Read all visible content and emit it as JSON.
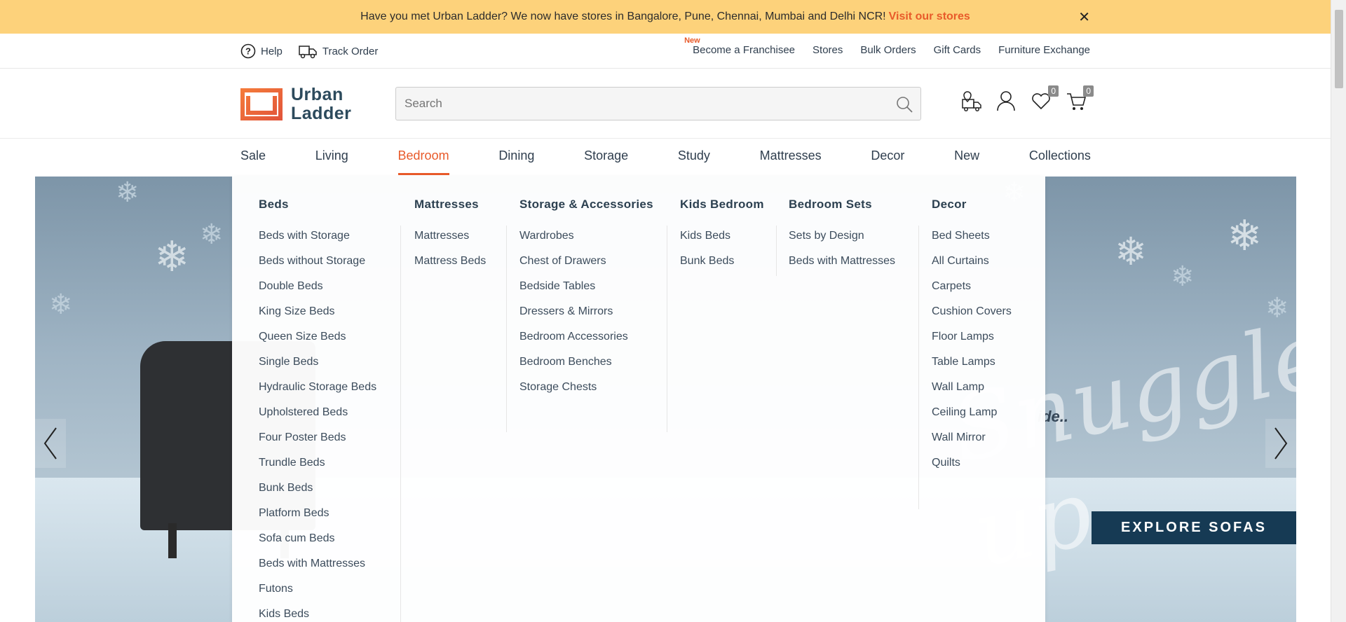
{
  "announcement": {
    "text": "Have you met Urban Ladder? We now have stores in Bangalore, Pune, Chennai, Mumbai and Delhi NCR!",
    "link": "Visit our stores",
    "close": "✕"
  },
  "util": {
    "help": "Help",
    "track": "Track Order",
    "new_badge": "New",
    "links": [
      "Become a Franchisee",
      "Stores",
      "Bulk Orders",
      "Gift Cards",
      "Furniture Exchange"
    ]
  },
  "header": {
    "logo_line1": "Urban",
    "logo_line2": "Ladder",
    "search_placeholder": "Search",
    "wishlist_count": "0",
    "cart_count": "0"
  },
  "nav": [
    "Sale",
    "Living",
    "Bedroom",
    "Dining",
    "Storage",
    "Study",
    "Mattresses",
    "Decor",
    "New",
    "Collections"
  ],
  "nav_active": "Bedroom",
  "hero": {
    "script_text": "Snuggle up",
    "tag_text": "ide..",
    "cta": "EXPLORE SOFAS"
  },
  "mega_menu": [
    {
      "title": "Beds",
      "items": [
        "Beds with Storage",
        "Beds without Storage",
        "Double Beds",
        "King Size Beds",
        "Queen Size Beds",
        "Single Beds",
        "Hydraulic Storage Beds",
        "Upholstered Beds",
        "Four Poster Beds",
        "Trundle Beds",
        "Bunk Beds",
        "Platform Beds",
        "Sofa cum Beds",
        "Beds with Mattresses",
        "Futons",
        "Kids Beds"
      ]
    },
    {
      "title": "Mattresses",
      "items": [
        "Mattresses",
        "Mattress Beds"
      ]
    },
    {
      "title": "Storage & Accessories",
      "items": [
        "Wardrobes",
        "Chest of Drawers",
        "Bedside Tables",
        "Dressers & Mirrors",
        "Bedroom Accessories",
        "Bedroom Benches",
        "Storage Chests"
      ]
    },
    {
      "title": "Kids Bedroom",
      "items": [
        "Kids Beds",
        "Bunk Beds"
      ]
    },
    {
      "title": "Bedroom Sets",
      "items": [
        "Sets by Design",
        "Beds with Mattresses"
      ]
    },
    {
      "title": "Decor",
      "items": [
        "Bed Sheets",
        "All Curtains",
        "Carpets",
        "Cushion Covers",
        "Floor Lamps",
        "Table Lamps",
        "Wall Lamp",
        "Ceiling Lamp",
        "Wall Mirror",
        "Quilts"
      ]
    }
  ],
  "colors": {
    "accent": "#e85a2a",
    "banner": "#fdd27b",
    "cta": "#163a54"
  }
}
